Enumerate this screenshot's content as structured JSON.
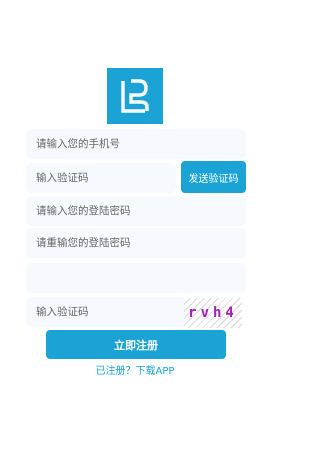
{
  "brand": {
    "logo_icon": "lb-monogram-logo",
    "accent_color": "#1aa3d4"
  },
  "form": {
    "phone_placeholder": "请输入您的手机号",
    "sms_code_placeholder": "输入验证码",
    "send_code_label": "发送验证码",
    "password_placeholder": "请输入您的登陆密码",
    "confirm_password_placeholder": "请重输您的登陆密码",
    "extra_field_placeholder": "",
    "captcha_placeholder": "输入验证码",
    "captcha_text": "rvh4",
    "submit_label": "立即注册",
    "footer_link_label": "已注册？下载APP"
  }
}
